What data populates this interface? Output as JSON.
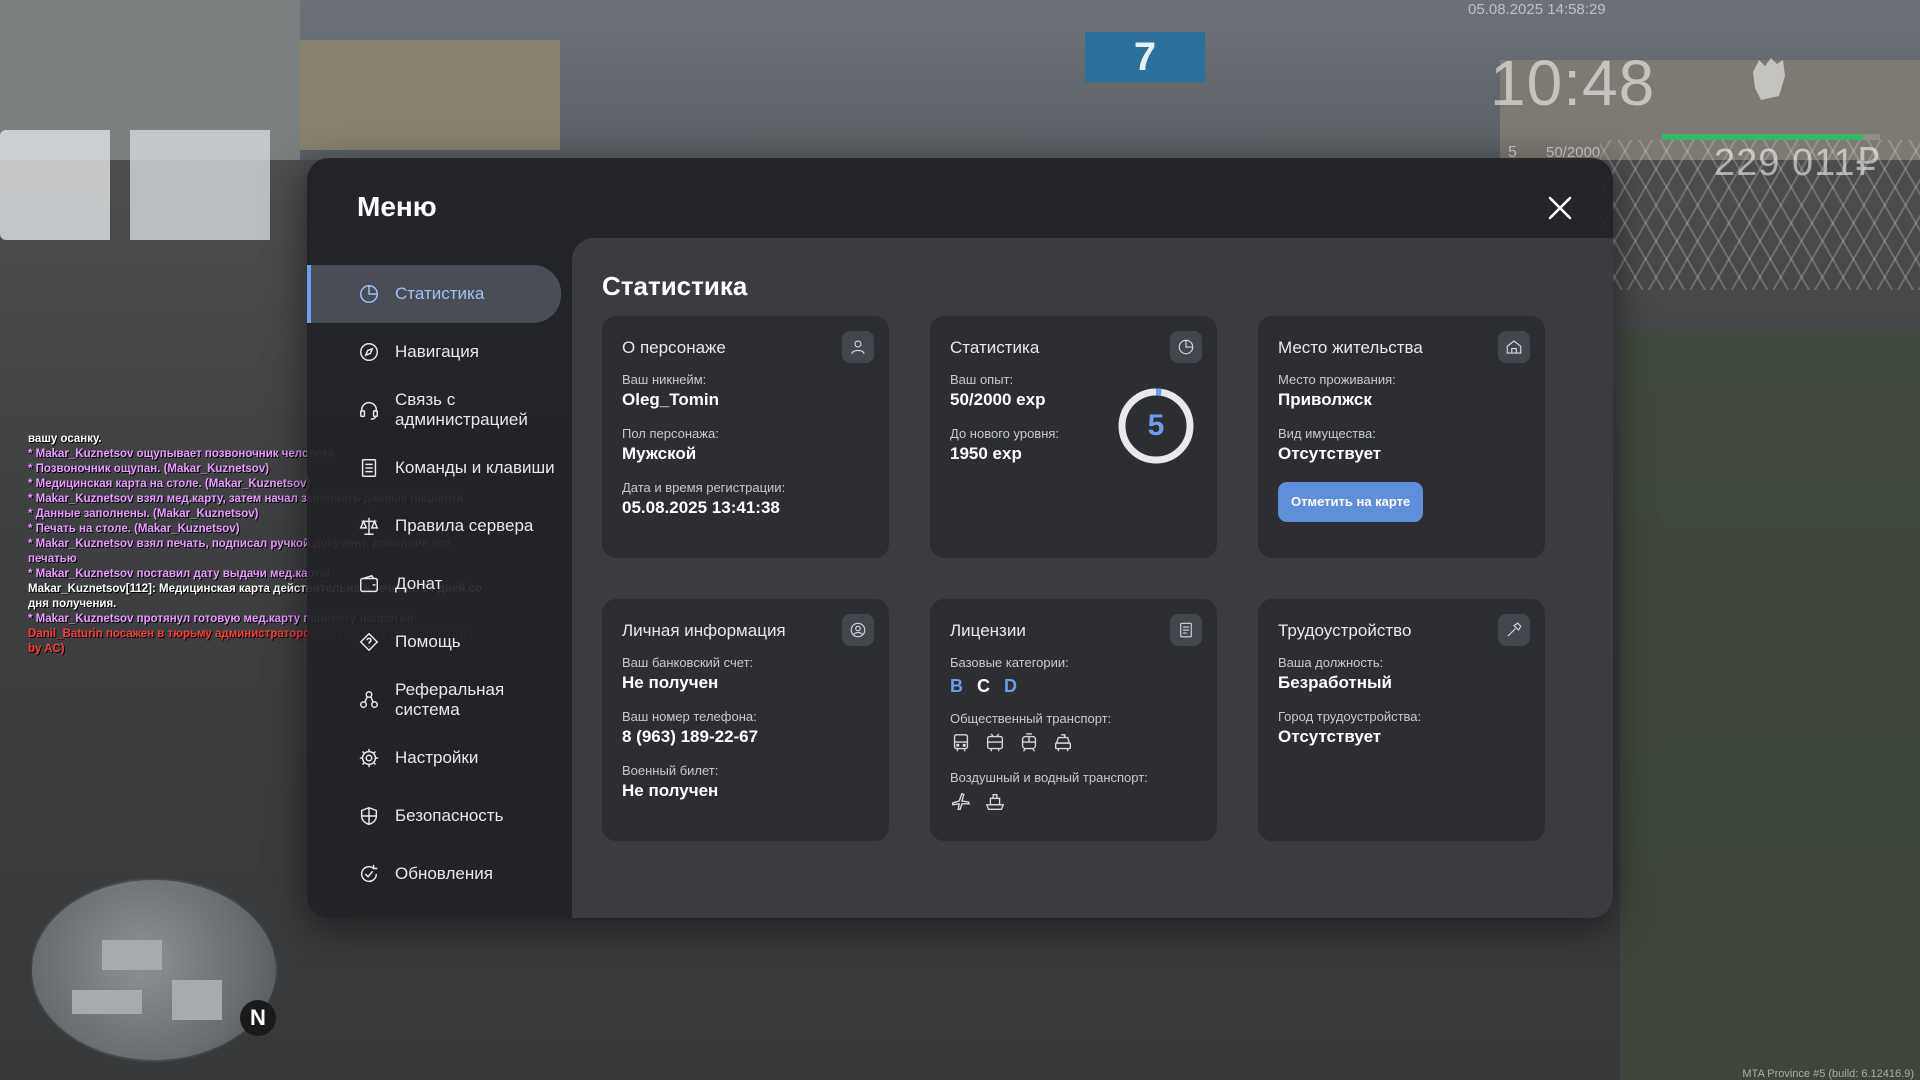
{
  "hud": {
    "datetime": "05.08.2025 14:58:29",
    "clock": "10:48",
    "level": "5",
    "exp": "50/2000",
    "money": "229 011₽",
    "health_fraction": 0.92
  },
  "chat": [
    {
      "text": "вашу осанку.",
      "color": "w"
    },
    {
      "text": "* Makar_Kuznetsov ощупывает позвоночник человека",
      "color": "p"
    },
    {
      "text": "* Позвоночник ощупан. (Makar_Kuznetsov)",
      "color": "p"
    },
    {
      "text": "* Медицинская карта на столе. (Makar_Kuznetsov)",
      "color": "p"
    },
    {
      "text": "* Makar_Kuznetsov взял мед.карту, затем начал заполнять данные пациента",
      "color": "p"
    },
    {
      "text": "* Данные заполнены. (Makar_Kuznetsov)",
      "color": "p"
    },
    {
      "text": "* Печать на столе. (Makar_Kuznetsov)",
      "color": "p"
    },
    {
      "text": "* Makar_Kuznetsov взял печать, подписал ручкой документ, дополнив его",
      "color": "p"
    },
    {
      "text": "печатью",
      "color": "p"
    },
    {
      "text": "* Makar_Kuznetsov поставил дату выдачи мед.карты",
      "color": "p"
    },
    {
      "text": "Makar_Kuznetsov[112]: Медицинская карта действительна в течение 14 дней со",
      "color": "w"
    },
    {
      "text": "дня получения.",
      "color": "w"
    },
    {
      "text": "* Makar_Kuznetsov протянул готовую мед.карту пациенту напротив",
      "color": "p"
    },
    {
      "text": "Danil_Baturin посажен в тюрьму администратором Amin_Gerry (30 мин.) [ПП]",
      "color": "r"
    },
    {
      "text": "by AC)",
      "color": "r"
    }
  ],
  "build_info": "MTA Province #5 (build: 6.12416.9)",
  "compass": "N",
  "menu": {
    "title": "Меню",
    "items": [
      {
        "label": "Статистика",
        "icon": "pie-chart-icon",
        "name": "sidebar-item-statistics"
      },
      {
        "label": "Навигация",
        "icon": "compass-icon",
        "name": "sidebar-item-navigation"
      },
      {
        "label": "Связь с администрацией",
        "icon": "headset-icon",
        "name": "sidebar-item-admin-contact"
      },
      {
        "label": "Команды и клавиши",
        "icon": "list-icon",
        "name": "sidebar-item-commands"
      },
      {
        "label": "Правила сервера",
        "icon": "scales-icon",
        "name": "sidebar-item-rules"
      },
      {
        "label": "Донат",
        "icon": "wallet-icon",
        "name": "sidebar-item-donate"
      },
      {
        "label": "Помощь",
        "icon": "help-icon",
        "name": "sidebar-item-help"
      },
      {
        "label": "Реферальная система",
        "icon": "referral-icon",
        "name": "sidebar-item-referral"
      },
      {
        "label": "Настройки",
        "icon": "gear-icon",
        "name": "sidebar-item-settings"
      },
      {
        "label": "Безопасность",
        "icon": "shield-icon",
        "name": "sidebar-item-security"
      },
      {
        "label": "Обновления",
        "icon": "refresh-icon",
        "name": "sidebar-item-updates"
      }
    ]
  },
  "content": {
    "title": "Статистика",
    "character": {
      "head": "О персонаже",
      "nick_label": "Ваш никнейм:",
      "nick": "Oleg_Tomin",
      "gender_label": "Пол персонажа:",
      "gender": "Мужской",
      "reg_label": "Дата и время регистрации:",
      "reg": "05.08.2025 13:41:38"
    },
    "stats": {
      "head": "Статистика",
      "exp_label": "Ваш опыт:",
      "exp": "50/2000 exp",
      "next_label": "До нового уровня:",
      "next": "1950 exp",
      "level": "5",
      "progress": 0.025
    },
    "residence": {
      "head": "Место жительства",
      "place_label": "Место проживания:",
      "place": "Приволжск",
      "prop_label": "Вид имущества:",
      "prop": "Отсутствует",
      "map_button": "Отметить на карте"
    },
    "personal": {
      "head": "Личная информация",
      "bank_label": "Ваш банковский счет:",
      "bank": "Не получен",
      "phone_label": "Ваш номер телефона:",
      "phone": "8 (963) 189-22-67",
      "military_label": "Военный билет:",
      "military": "Не получен"
    },
    "licenses": {
      "head": "Лицензии",
      "base_label": "Базовые категории:",
      "cats": [
        {
          "letter": "B",
          "active": true
        },
        {
          "letter": "C",
          "active": false
        },
        {
          "letter": "D",
          "active": true
        }
      ],
      "public_label": "Общественный транспорт:",
      "air_label": "Воздушный и водный транспорт:"
    },
    "job": {
      "head": "Трудоустройство",
      "position_label": "Ваша должность:",
      "position": "Безработный",
      "city_label": "Город трудоустройства:",
      "city": "Отсутствует"
    }
  },
  "colors": {
    "accent": "#6c9fe6",
    "button": "#5e8fdb",
    "panel": "#3a3c41",
    "card": "#2c2e32"
  }
}
